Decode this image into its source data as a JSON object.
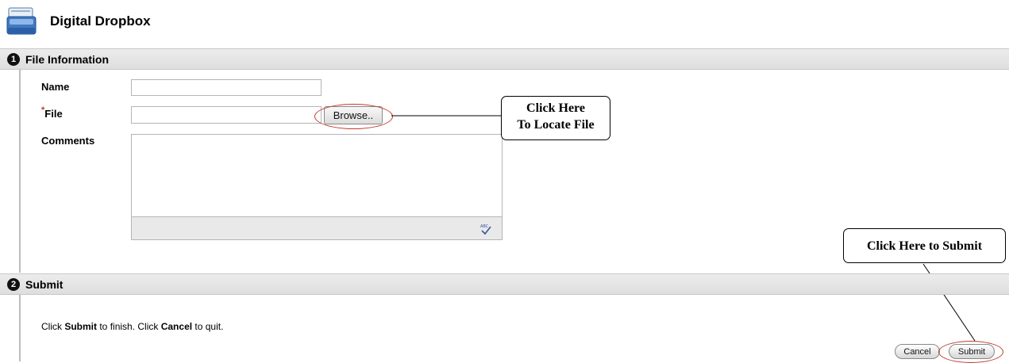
{
  "header": {
    "title": "Digital Dropbox",
    "icon": "dropbox-icon"
  },
  "sections": [
    {
      "number": "1",
      "title": "File Information"
    },
    {
      "number": "2",
      "title": "Submit"
    }
  ],
  "form": {
    "name_label": "Name",
    "file_required_marker": "*",
    "file_label": "File",
    "comments_label": "Comments",
    "name_value": "",
    "file_value": "",
    "comments_value": "",
    "browse_label": "Browse..",
    "spellcheck_icon": "spellcheck-icon"
  },
  "callouts": {
    "locate_line1": "Click Here",
    "locate_line2": "To Locate File",
    "submit": "Click Here to Submit"
  },
  "submit_section": {
    "instructions": {
      "part1": "Click ",
      "bold1": "Submit",
      "part2": " to finish. Click ",
      "bold2": "Cancel",
      "part3": " to quit."
    },
    "cancel_label": "Cancel",
    "submit_label": "Submit"
  },
  "colors": {
    "required": "#c0392b",
    "annotation_ring": "#c0392b",
    "section_bar": "#e4e4e4"
  }
}
